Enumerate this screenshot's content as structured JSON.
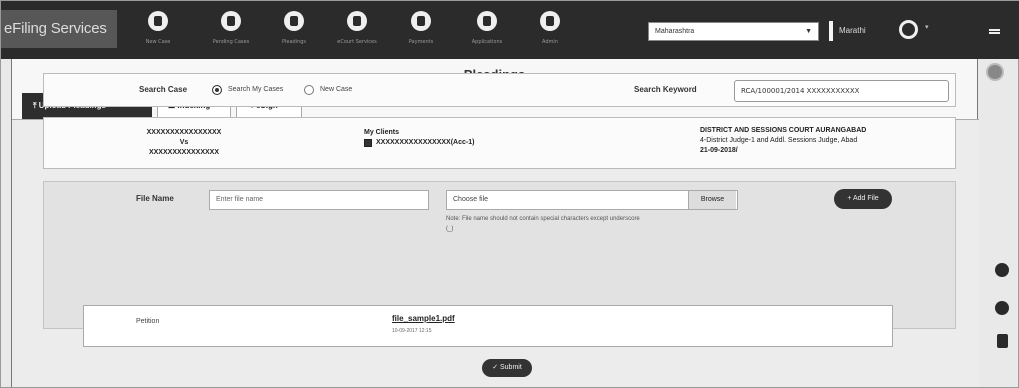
{
  "header": {
    "brand": "eFiling Services",
    "nav_items": [
      {
        "icon": "plus-circle-icon",
        "label": "New Case"
      },
      {
        "icon": "edit-icon",
        "label": "Pending Cases"
      },
      {
        "icon": "document-icon",
        "label": "Pleadings"
      },
      {
        "icon": "globe-icon",
        "label": "eCourt Services"
      },
      {
        "icon": "rupee-icon",
        "label": "Payments"
      },
      {
        "icon": "download-icon",
        "label": "Applications"
      },
      {
        "icon": "settings-icon",
        "label": "Admin"
      }
    ],
    "state_select": "Maharashtra",
    "language": "Marathi"
  },
  "page": {
    "title": "Pleadings",
    "tabs": [
      {
        "label": "Upload Pleadings",
        "icon": "upload-icon",
        "active": true
      },
      {
        "label": "Indexing",
        "icon": "list-icon",
        "active": false
      },
      {
        "label": "eSign",
        "icon": "user-sign-icon",
        "active": false
      }
    ]
  },
  "search": {
    "label": "Search Case",
    "option_my_cases": "Search My Cases",
    "option_new_case": "New Case",
    "keyword_label": "Search Keyword",
    "keyword_value": "RCA/100001/2014 XXXXXXXXXXX"
  },
  "case_info": {
    "party_1": "XXXXXXXXXXXXXXXX",
    "vs": "Vs",
    "party_2": "XXXXXXXXXXXXXXX",
    "clients_label": "My Clients",
    "client_value": "XXXXXXXXXXXXXXXX(Acc-1)",
    "court_name": "DISTRICT AND SESSIONS COURT AURANGABAD",
    "court_detail": "4-District Judge-1 and Addl. Sessions Judge, Abad",
    "court_date": "21-09-2018/"
  },
  "upload": {
    "file_name_label": "File Name",
    "file_name_placeholder": "Enter file name",
    "choose_file": "Choose file",
    "browse": "Browse",
    "note": "Note: File name should not contain special characters except underscore",
    "note_2": "(_)",
    "add_file": "+ Add File"
  },
  "files": [
    {
      "name": "Petition",
      "link": "file_sample1.pdf",
      "date": "10-09-2017 12:15"
    }
  ],
  "submit_label": "✓ Submit"
}
